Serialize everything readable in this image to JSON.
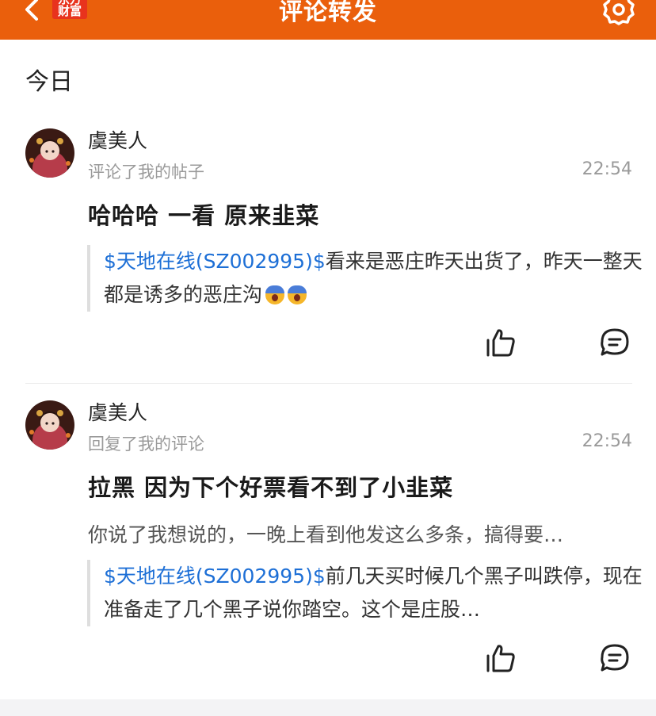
{
  "header": {
    "title": "评论转发",
    "logo_line1": "东方",
    "logo_line2": "财富",
    "back_icon": "chevron-left-icon",
    "settings_icon": "gear-icon",
    "bg_color": "#ea5f0c"
  },
  "section": {
    "title": "今日"
  },
  "notifications": [
    {
      "user": "虞美人",
      "action": "评论了我的帖子",
      "time": "22:54",
      "content": "哈哈哈  一看  原来韭菜",
      "reply": "",
      "quote_tag": "$天地在线(SZ002995)$",
      "quote_text": "看来是恶庄昨天出货了，昨天一整天都是诱多的恶庄沟"
    },
    {
      "user": "虞美人",
      "action": "回复了我的评论",
      "time": "22:54",
      "content": "拉黑  因为下个好票看不到了小韭菜",
      "reply": "你说了我想说的，一晚上看到他发这么多条，搞得要…",
      "quote_tag": "$天地在线(SZ002995)$",
      "quote_text": "前几天买时候几个黑子叫跌停，现在准备走了几个黑子说你踏空。这个是庄股…"
    }
  ],
  "colors": {
    "link": "#1d6fd6",
    "secondary_text": "#9a9a9a"
  }
}
